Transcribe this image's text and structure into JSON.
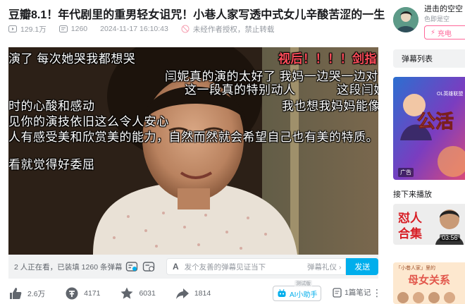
{
  "header": {
    "title": "豆瓣8.1！年代剧里的重男轻女诅咒！小巷人家写透中式女儿辛酸苦涩的一生",
    "views": "129.1万",
    "danmaku_count": "1260",
    "date": "2024-11-17 16:10:43",
    "copyright": "未经作者授权，禁止转载"
  },
  "video": {
    "danmaku": [
      {
        "text": "演了 每次她哭我都想哭"
      },
      {
        "text": "视后！！！！剑指"
      },
      {
        "text": "闫妮真的演的太好了 我妈一边哭一边对"
      },
      {
        "text": "这一段真的特别动人"
      },
      {
        "text": "这段闫妮"
      },
      {
        "text": "时的心酸和感动"
      },
      {
        "text": "我也想我妈妈能像"
      },
      {
        "text": "见你的演技依旧这么令人安心"
      },
      {
        "text": "人有感受美和欣赏美的能力，自然而然就会希望自己也有美的特质。"
      },
      {
        "text": "看就觉得好委屈"
      }
    ]
  },
  "danmaku_bar": {
    "watching": "2 人正在看，已装填 1260 条弹幕",
    "input_placeholder": "发个友善的弹幕见证当下",
    "etiquette": "弹幕礼仪 ›",
    "send": "发送"
  },
  "actions": {
    "like": "2.6万",
    "coin": "4171",
    "favorite": "6031",
    "share": "1814",
    "ai_assistant": "AI小助手",
    "ai_tag": "测试版",
    "notes": "1篇笔记",
    "more": "⋮"
  },
  "sidebar": {
    "up_name": "进击的空空",
    "up_desc": "色即是空",
    "charge": "充电",
    "danmaku_list": "弹幕列表",
    "ad_label": "广告",
    "ad_banner": "公活",
    "ad_small_text": "OL英雄联盟",
    "next_play": "接下来播放",
    "thumb1_text1": "怼人",
    "thumb1_text2": "合集",
    "thumb1_duration": "03:56",
    "thumb2_top": "「小巷人家」里的",
    "thumb2_text": "母女关系"
  },
  "colors": {
    "accent": "#00aeec",
    "pink": "#ff6699",
    "danmaku_red": "#ff4d5a"
  }
}
